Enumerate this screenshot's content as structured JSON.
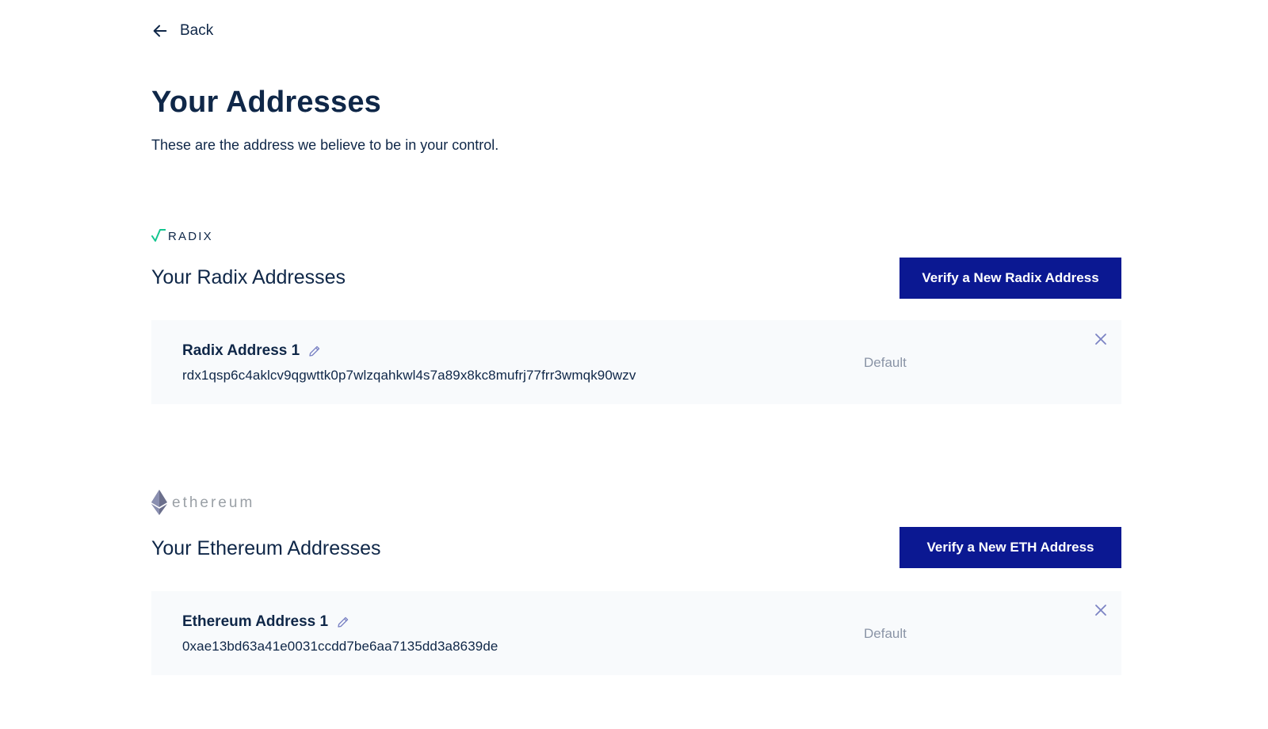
{
  "nav": {
    "back_label": "Back"
  },
  "page": {
    "title": "Your Addresses",
    "subtitle": "These are the address we believe to be in your control."
  },
  "radix": {
    "logo_text": "RADIX",
    "section_title": "Your Radix Addresses",
    "verify_label": "Verify a New Radix Address",
    "addresses": [
      {
        "name": "Radix Address 1",
        "value": "rdx1qsp6c4aklcv9qgwttk0p7wlzqahkwl4s7a89x8kc8mufrj77frr3wmqk90wzv",
        "default_label": "Default"
      }
    ]
  },
  "ethereum": {
    "logo_text": "ethereum",
    "section_title": "Your Ethereum Addresses",
    "verify_label": "Verify a New ETH Address",
    "addresses": [
      {
        "name": "Ethereum Address 1",
        "value": "0xae13bd63a41e0031ccdd7be6aa7135dd3a8639de",
        "default_label": "Default"
      }
    ]
  },
  "colors": {
    "primary_button": "#0b1892",
    "text_dark": "#0f2748",
    "muted": "#8a94a6",
    "card_bg": "#f8fafc",
    "radix_accent": "#14c68f",
    "edit_icon": "#7b83c4"
  },
  "icons": {
    "back": "arrow-left-icon",
    "edit": "pencil-icon",
    "remove": "close-icon",
    "radix_logo": "radix-logo-icon",
    "ethereum_logo": "ethereum-diamond-icon"
  }
}
